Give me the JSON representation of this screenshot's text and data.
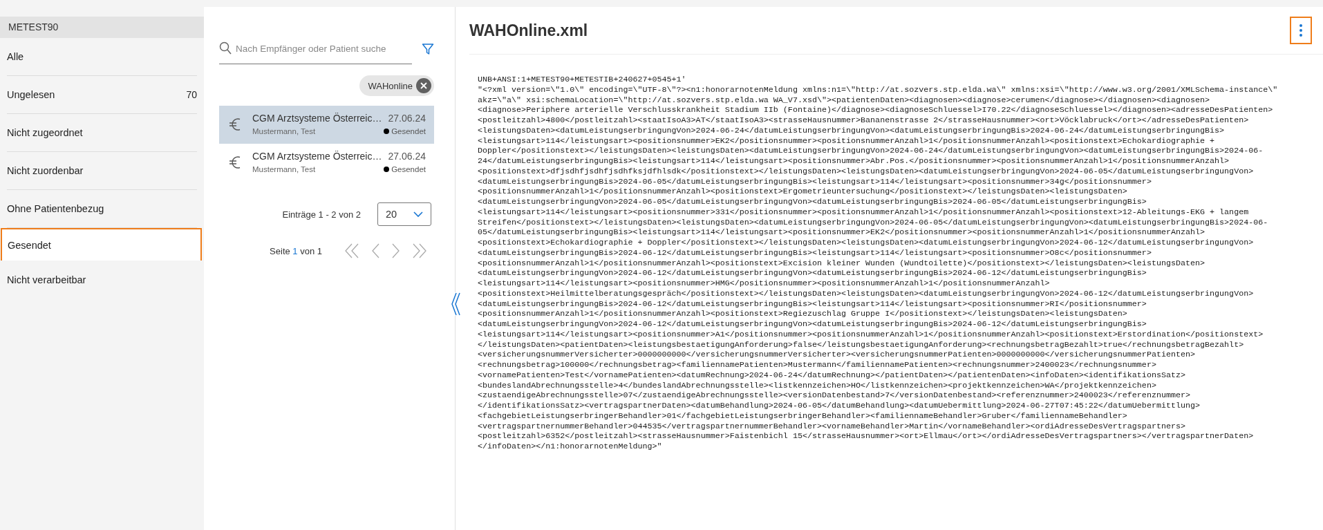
{
  "sidebar": {
    "account": "METEST90",
    "items": [
      {
        "label": "Alle",
        "selected": false
      },
      {
        "label": "Ungelesen",
        "count": "70",
        "selected": false
      },
      {
        "label": "Nicht zugeordnet",
        "selected": false
      },
      {
        "label": "Nicht zuordenbar",
        "selected": false
      },
      {
        "label": "Ohne Patientenbezug",
        "selected": false
      },
      {
        "label": "Gesendet",
        "selected": true
      },
      {
        "label": "Nicht verarbeitbar",
        "selected": false
      }
    ]
  },
  "message_list": {
    "search": {
      "placeholder": "Nach Empfänger oder Patient suche"
    },
    "filter_chip": "WAHonline",
    "messages": [
      {
        "sender": "CGM Arztsysteme Österreic…",
        "date": "27.06.24",
        "patient": "Mustermann, Test",
        "status": "Gesendet",
        "selected": true
      },
      {
        "sender": "CGM Arztsysteme Österreic…",
        "date": "27.06.24",
        "patient": "Mustermann, Test",
        "status": "Gesendet",
        "selected": false
      }
    ],
    "entries_label": "Einträge 1 - 2 von 2",
    "page_size": "20",
    "pager": {
      "prefix": "Seite",
      "current": "1",
      "suffix": "von 1"
    }
  },
  "document": {
    "title": "WAHOnline.xml",
    "menu_focused": true,
    "content": [
      "UNB+ANSI:1+METEST90+METESTIB+240627+0545+1'",
      "\"<?xml version=\\\"1.0\\\" encoding=\\\"UTF-8\\\"?><n1:honorarnotenMeldung xmlns:n1=\\\"http://at.sozvers.stp.elda.wa\\\" xmlns:xsi=\\\"http://www.w3.org/2001/XMLSchema-instance\\\"",
      "akz=\\\"a\\\" xsi:schemaLocation=\\\"http://at.sozvers.stp.elda.wa WA_V7.xsd\\\"><patientenDaten><diagnosen><diagnose>cerumen</diagnose></diagnosen><diagnosen>",
      "<diagnose>Periphere arterielle Verschlusskrankheit Stadium IIb (Fontaine)</diagnose><diagnoseSchluessel>I70.22</diagnoseSchluessel></diagnosen><adresseDesPatienten>",
      "<postleitzahl>4800</postleitzahl><staatIsoA3>AT</staatIsoA3><strasseHausnummer>Bananenstrasse 2</strasseHausnummer><ort>Vöcklabruck</ort></adresseDesPatienten>",
      "<leistungsDaten><datumLeistungserbringungVon>2024-06-24</datumLeistungserbringungVon><datumLeistungserbringungBis>2024-06-24</datumLeistungserbringungBis>",
      "<leistungsart>114</leistungsart><positionsnummer>EK2</positionsnummer><positionsnummerAnzahl>1</positionsnummerAnzahl><positionstext>Echokardiographie +",
      "Doppler</positionstext></leistungsDaten><leistungsDaten><datumLeistungserbringungVon>2024-06-24</datumLeistungserbringungVon><datumLeistungserbringungBis>2024-06-",
      "24</datumLeistungserbringungBis><leistungsart>114</leistungsart><positionsnummer>Abr.Pos.</positionsnummer><positionsnummerAnzahl>1</positionsnummerAnzahl>",
      "<positionstext>dfjsdhfjsdhfjsdhfksjdfhlsdk</positionstext></leistungsDaten><leistungsDaten><datumLeistungserbringungVon>2024-06-05</datumLeistungserbringungVon>",
      "<datumLeistungserbringungBis>2024-06-05</datumLeistungserbringungBis><leistungsart>114</leistungsart><positionsnummer>34g</positionsnummer>",
      "<positionsnummerAnzahl>1</positionsnummerAnzahl><positionstext>Ergometrieuntersuchung</positionstext></leistungsDaten><leistungsDaten>",
      "<datumLeistungserbringungVon>2024-06-05</datumLeistungserbringungVon><datumLeistungserbringungBis>2024-06-05</datumLeistungserbringungBis>",
      "<leistungsart>114</leistungsart><positionsnummer>331</positionsnummer><positionsnummerAnzahl>1</positionsnummerAnzahl><positionstext>12-Ableitungs-EKG + langem",
      "Streifen</positionstext></leistungsDaten><leistungsDaten><datumLeistungserbringungVon>2024-06-05</datumLeistungserbringungVon><datumLeistungserbringungBis>2024-06-",
      "05</datumLeistungserbringungBis><leistungsart>114</leistungsart><positionsnummer>EK2</positionsnummer><positionsnummerAnzahl>1</positionsnummerAnzahl>",
      "<positionstext>Echokardiographie + Doppler</positionstext></leistungsDaten><leistungsDaten><datumLeistungserbringungVon>2024-06-12</datumLeistungserbringungVon>",
      "<datumLeistungserbringungBis>2024-06-12</datumLeistungserbringungBis><leistungsart>114</leistungsart><positionsnummer>O8c</positionsnummer>",
      "<positionsnummerAnzahl>1</positionsnummerAnzahl><positionstext>Excision kleiner Wunden (Wundtoilette)</positionstext></leistungsDaten><leistungsDaten>",
      "<datumLeistungserbringungVon>2024-06-12</datumLeistungserbringungVon><datumLeistungserbringungBis>2024-06-12</datumLeistungserbringungBis>",
      "<leistungsart>114</leistungsart><positionsnummer>HMG</positionsnummer><positionsnummerAnzahl>1</positionsnummerAnzahl>",
      "<positionstext>Heilmittelberatungsgespräch</positionstext></leistungsDaten><leistungsDaten><datumLeistungserbringungVon>2024-06-12</datumLeistungserbringungVon>",
      "<datumLeistungserbringungBis>2024-06-12</datumLeistungserbringungBis><leistungsart>114</leistungsart><positionsnummer>RI</positionsnummer>",
      "<positionsnummerAnzahl>1</positionsnummerAnzahl><positionstext>Regiezuschlag Gruppe I</positionstext></leistungsDaten><leistungsDaten>",
      "<datumLeistungserbringungVon>2024-06-12</datumLeistungserbringungVon><datumLeistungserbringungBis>2024-06-12</datumLeistungserbringungBis>",
      "<leistungsart>114</leistungsart><positionsnummer>A1</positionsnummer><positionsnummerAnzahl>1</positionsnummerAnzahl><positionstext>Erstordination</positionstext>",
      "</leistungsDaten><patientDaten><leistungsbestaetigungAnforderung>false</leistungsbestaetigungAnforderung><rechnungsbetragBezahlt>true</rechnungsbetragBezahlt>",
      "<versicherungsnummerVersicherter>0000000000</versicherungsnummerVersicherter><versicherungsnummerPatienten>0000000000</versicherungsnummerPatienten>",
      "<rechnungsbetrag>100000</rechnungsbetrag><familiennamePatienten>Mustermann</familiennamePatienten><rechnungsnummer>2400023</rechnungsnummer>",
      "<vornamePatienten>Test</vornamePatienten><datumRechnung>2024-06-24</datumRechnung></patientDaten></patientenDaten><infoDaten><identifikationsSatz>",
      "<bundeslandAbrechnungsstelle>4</bundeslandAbrechnungsstelle><listkennzeichen>HO</listkennzeichen><projektkennzeichen>WA</projektkennzeichen>",
      "<zustaendigeAbrechnungsstelle>07</zustaendigeAbrechnungsstelle><versionDatenbestand>7</versionDatenbestand><referenznummer>2400023</referenznummer>",
      "</identifikationsSatz><vertragspartnerDaten><datumBehandlung>2024-06-05</datumBehandlung><datumUebermittlung>2024-06-27T07:45:22</datumUebermittlung>",
      "<fachgebietLeistungserbringerBehandler>01</fachgebietLeistungserbringerBehandler><familiennameBehandler>Gruber</familiennameBehandler>",
      "<vertragspartnernummerBehandler>044535</vertragspartnernummerBehandler><vornameBehandler>Martin</vornameBehandler><ordiAdresseDesVertragspartners>",
      "<postleitzahl>6352</postleitzahl><strasseHausnummer>Faistenbichl 15</strasseHausnummer><ort>Ellmau</ort></ordiAdresseDesVertragspartners></vertragspartnerDaten>",
      "</infoDaten></n1:honorarnotenMeldung>\""
    ]
  }
}
